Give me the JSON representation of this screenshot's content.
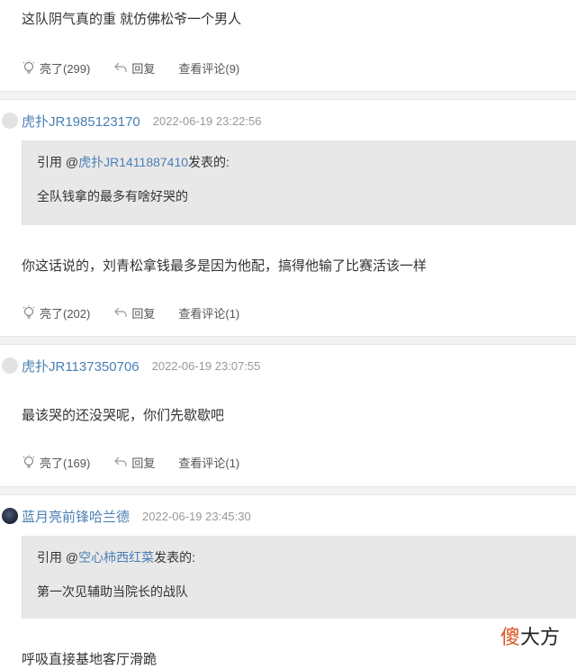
{
  "comments": [
    {
      "text": "这队阴气真的重 就仿佛松爷一个男人",
      "actions": {
        "like": "亮了(299)",
        "reply": "回复",
        "view": "查看评论(9)"
      }
    },
    {
      "username": "虎扑JR1985123170",
      "time": "2022-06-19 23:22:56",
      "quote": {
        "prefix": "引用 @",
        "user": "虎扑JR1411887410",
        "suffix": "发表的:",
        "text": "全队钱拿的最多有啥好哭的"
      },
      "text": "你这话说的，刘青松拿钱最多是因为他配，搞得他输了比赛活该一样",
      "actions": {
        "like": "亮了(202)",
        "reply": "回复",
        "view": "查看评论(1)"
      }
    },
    {
      "username": "虎扑JR1137350706",
      "time": "2022-06-19 23:07:55",
      "text": "最该哭的还没哭呢，你们先歇歇吧",
      "actions": {
        "like": "亮了(169)",
        "reply": "回复",
        "view": "查看评论(1)"
      }
    },
    {
      "username": "蓝月亮前锋哈兰德",
      "time": "2022-06-19 23:45:30",
      "quote": {
        "prefix": "引用 @",
        "user": "空心柿西红菜",
        "suffix": "发表的:",
        "text": "第一次见辅助当院长的战队"
      },
      "text": "呼吸直接基地客厅滑跪"
    }
  ],
  "watermark": {
    "part1": "傻",
    "part2": "大方"
  },
  "colors": {
    "link": "#4a7fb5",
    "quote_bg": "#e8e8e8",
    "separator": "#f2f2f2"
  }
}
